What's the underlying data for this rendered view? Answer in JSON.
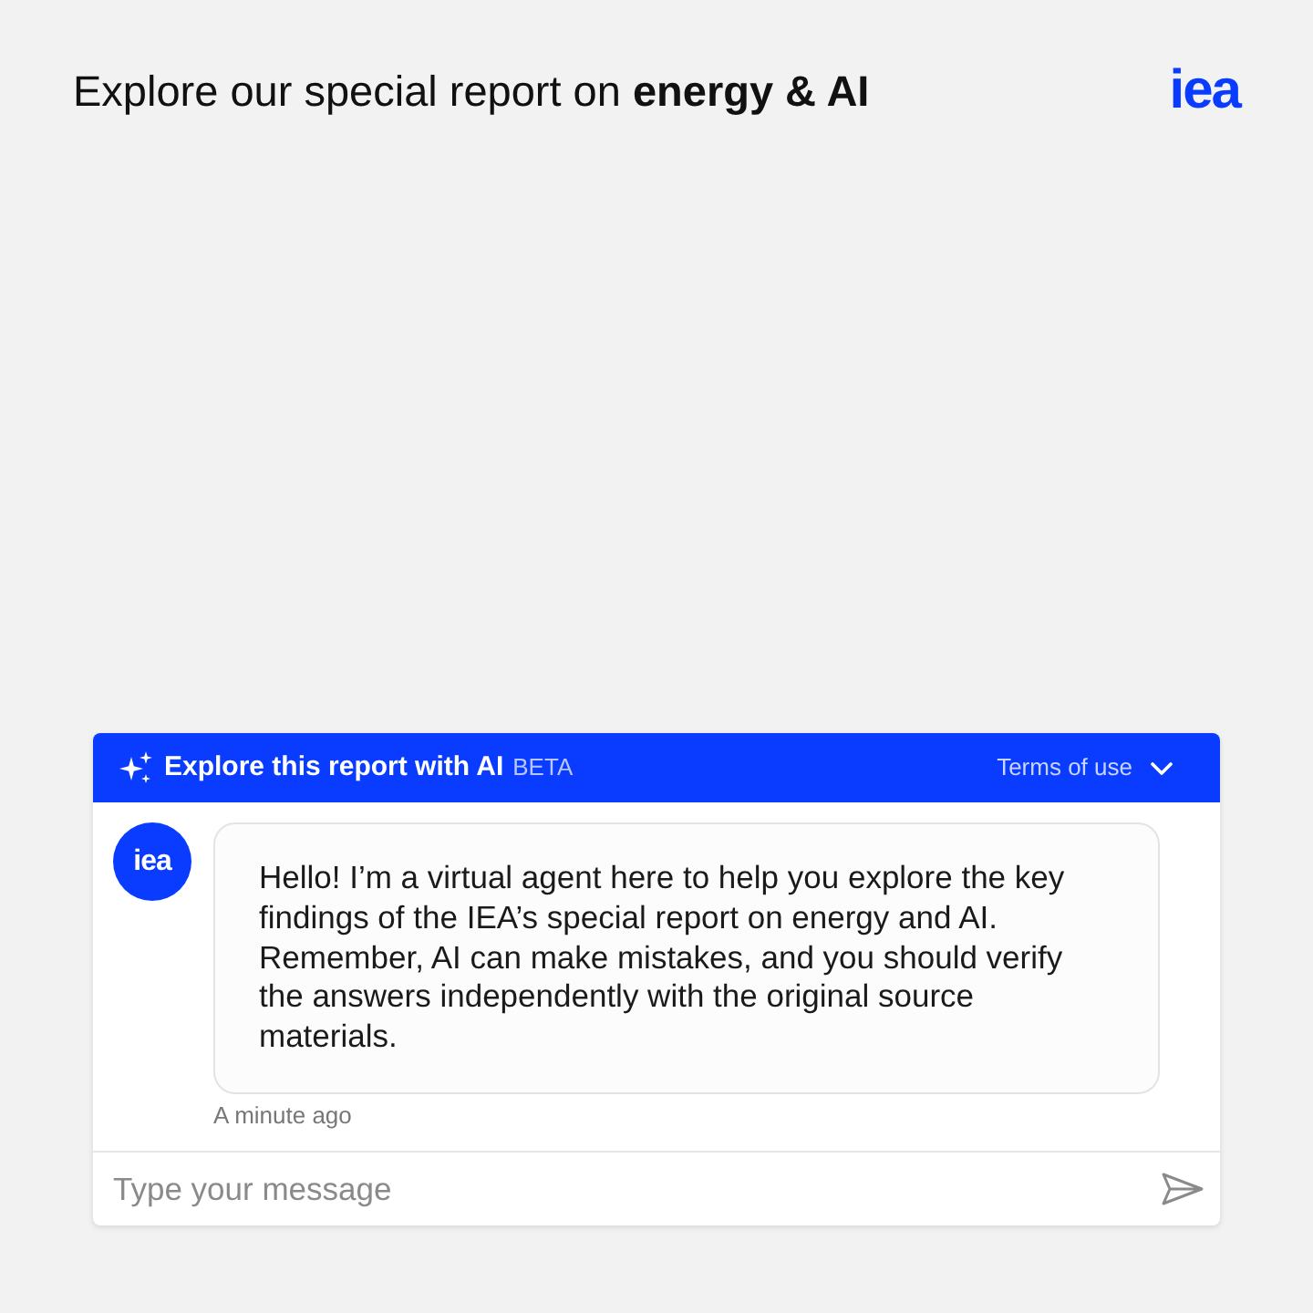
{
  "page": {
    "title": "Explore our special report on **energy & AI**",
    "logo": "iea"
  },
  "chat": {
    "header": {
      "title": "Explore this report with AI",
      "badge": "BETA",
      "terms": "Terms of use"
    },
    "messages": [
      {
        "avatar": "iea",
        "text": "Hello! I’m a virtual agent here to help you explore the key findings of the IEA’s special report on energy and AI. Remember, AI can make mistakes, and you should verify the answers independently with the original source materials.",
        "time": "A minute ago"
      }
    ],
    "input": {
      "placeholder": "Type your message"
    }
  }
}
